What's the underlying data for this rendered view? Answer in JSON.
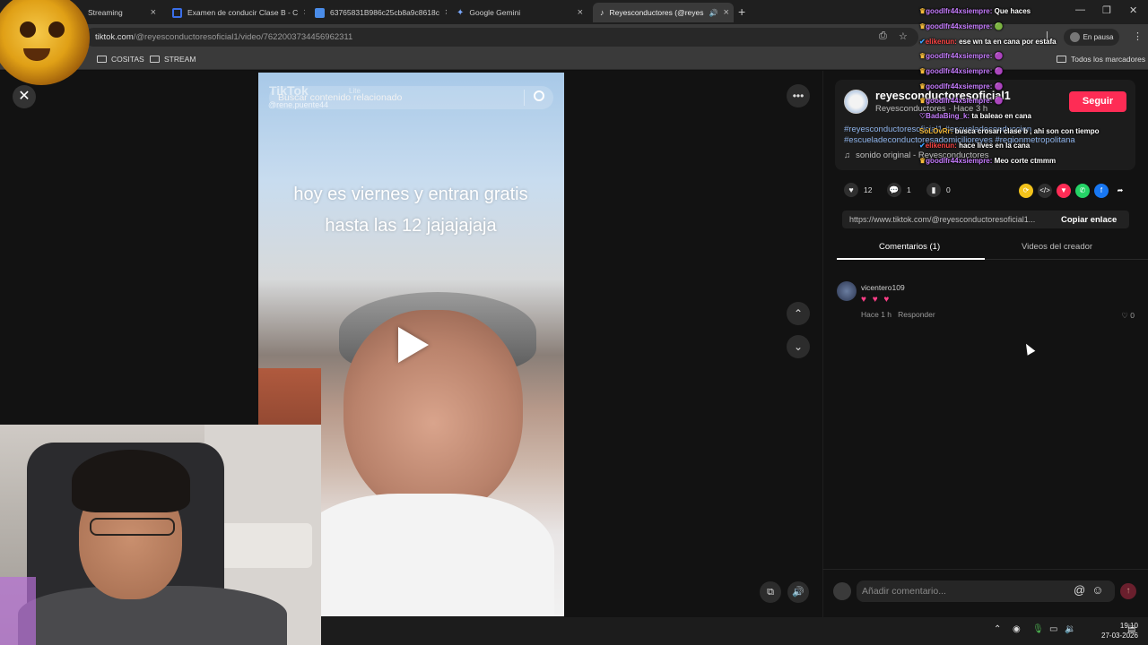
{
  "browser": {
    "tabs": [
      {
        "title": "Streaming",
        "favicon_color": "#e5e5e5"
      },
      {
        "title": "Examen de conducir Clase B - C",
        "favicon_color": "#3a6ee8"
      },
      {
        "title": "63765831B986c25cb8a9c8618c",
        "favicon_color": "#4a8ce8"
      },
      {
        "title": "Google Gemini",
        "favicon_color": "#4a8ce8"
      },
      {
        "title": "Reyesconductores (@reyes",
        "favicon_color": "#111111"
      }
    ],
    "url_domain": "tiktok.com",
    "url_path": "/@reyesconductoresoficial1/video/7622003734456962311",
    "profile_status": "En pausa",
    "bookmarks": [
      "COSITAS",
      "STREAM"
    ],
    "all_bookmarks": "Todos los marcadores"
  },
  "video": {
    "search_placeholder": "Buscar contenido relacionado",
    "watermark_logo": "TikTok",
    "watermark_lite": "Lite",
    "watermark_user": "@rene.puente44",
    "caption": "hoy es viernes y entran gratis hasta las 12 jajajajaja"
  },
  "post": {
    "username": "reyesconductoresoficial1",
    "subline": "Reyesconductores · Hace 3 h",
    "follow_label": "Seguir",
    "hashtags": "#reyesconductoresoficial1 #escueladeconduccion #escueladeconductoresadomicilioreyes #regionmetropolitana",
    "sound": "sonido original - Reyesconductores",
    "likes": "12",
    "comments": "1",
    "saves": "0",
    "link": "https://www.tiktok.com/@reyesconductoresoficial1...",
    "copy_label": "Copiar enlace",
    "tab_comments": "Comentarios (1)",
    "tab_creator": "Videos del creador"
  },
  "comment": {
    "user": "vicentero109",
    "text": "♥ ♥ ♥",
    "time": "Hace 1 h",
    "reply": "Responder",
    "likes": "0"
  },
  "comment_input": {
    "placeholder": "Añadir comentario..."
  },
  "chat": [
    {
      "user": "goodlfr44xsiempre:",
      "msg": "Que haces"
    },
    {
      "user": "goodlfr44xsiempre:",
      "msg": "🟢"
    },
    {
      "user": "elikenun:",
      "msg": "ese wn ta en cana por estafa"
    },
    {
      "user": "goodlfr44xsiempre:",
      "msg": "🟣"
    },
    {
      "user": "goodlfr44xsiempre:",
      "msg": "🟣"
    },
    {
      "user": "goodlfr44xsiempre:",
      "msg": "🟣"
    },
    {
      "user": "goodlfr44xsiempre:",
      "msg": "🟣"
    },
    {
      "user": "BadaBing_k:",
      "msg": "ta baleao en cana"
    },
    {
      "user": "SoLOvRr:",
      "msg": "busca crosari clase b , ahi son con tiempo"
    },
    {
      "user": "elikenun:",
      "msg": "hace lives en la cana"
    },
    {
      "user": "goodlfr44xsiempre:",
      "msg": "Meo corte ctmmm"
    }
  ],
  "system": {
    "time": "19:10",
    "date": "27-03-2026"
  },
  "colors": {
    "follow": "#fe2c55",
    "hashtag": "#8cb1e8",
    "chat_user": "#c77dff"
  }
}
